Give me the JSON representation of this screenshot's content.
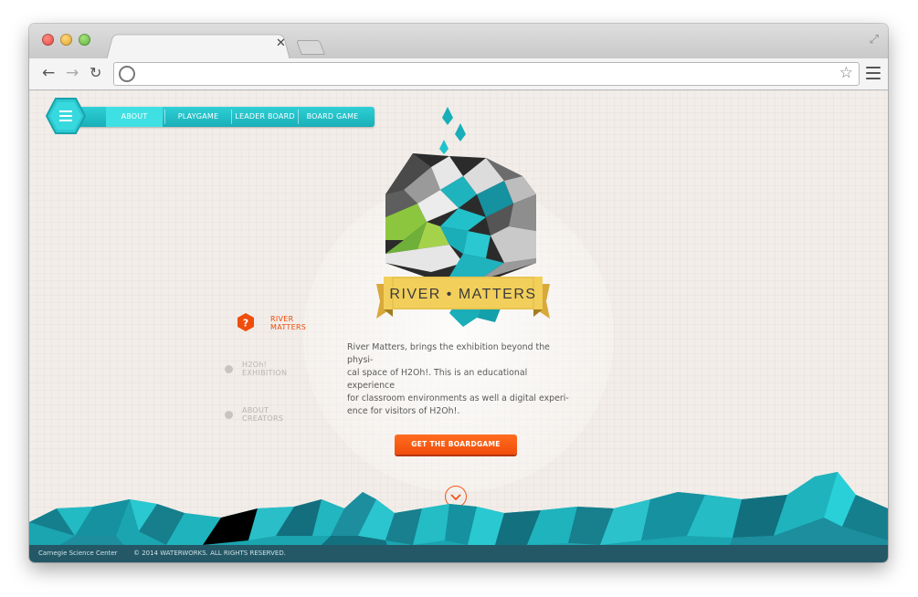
{
  "browser": {
    "url": "",
    "icons": {
      "back": "back-arrow-icon",
      "forward": "forward-arrow-icon",
      "reload": "reload-icon",
      "globe": "globe-icon",
      "star": "bookmark-star-icon",
      "menu": "hamburger-menu-icon",
      "fullscreen": "fullscreen-icon"
    }
  },
  "site": {
    "nav": {
      "items": [
        {
          "label": "ABOUT"
        },
        {
          "label": "PLAYGAME"
        },
        {
          "label": "LEADER BOARD"
        },
        {
          "label": "BOARD GAME"
        }
      ]
    },
    "logo": {
      "text": "RIVER • MATTERS"
    },
    "side_nav": {
      "items": [
        {
          "line1": "RIVER",
          "line2": "MATTERS"
        },
        {
          "line1": "H2Oh!",
          "line2": "EXHIBITION"
        },
        {
          "line1": "ABOUT",
          "line2": "CREATORS"
        }
      ]
    },
    "description": {
      "line1": "River Matters, brings the exhibition beyond the physi-",
      "line2": "cal space of H2Oh!. This is an educational experience",
      "line3": "for classroom environments as well a digital experi-",
      "line4": "ence for visitors of H2Oh!."
    },
    "cta_label": "GET THE BOARDGAME",
    "footer": {
      "left": "Carnegie Science Center",
      "right": "© 2014 WATERWORKS. ALL RIGHTS RESERVED."
    },
    "colors": {
      "accent_teal": "#19aeb8",
      "accent_orange": "#f04d0c",
      "footer_bg": "#245867"
    }
  }
}
